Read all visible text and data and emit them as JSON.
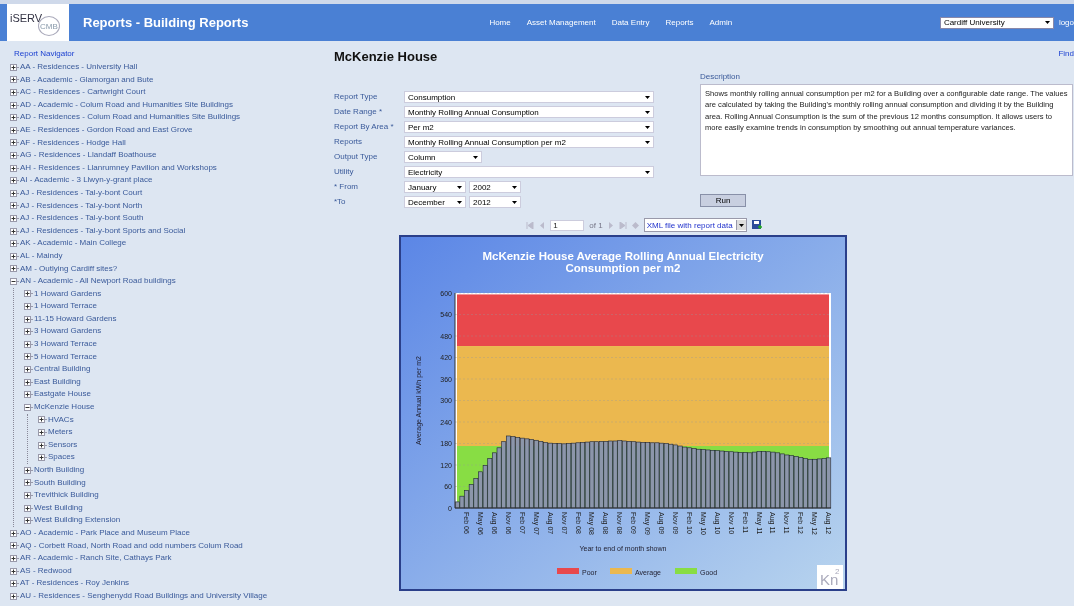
{
  "header": {
    "app_title": "Reports - Building Reports",
    "logo_text": "iSERV",
    "logo_sub": "CMB",
    "nav": [
      {
        "label": "Home"
      },
      {
        "label": "Asset Management"
      },
      {
        "label": "Data Entry"
      },
      {
        "label": "Reports"
      },
      {
        "label": "Admin"
      }
    ],
    "organisation": "Cardiff University",
    "logout": "logo"
  },
  "navigator": {
    "title": "Report Navigator",
    "tree": [
      {
        "label": "AA - Residences - University Hall",
        "expanded": false
      },
      {
        "label": "AB - Academic - Glamorgan and Bute",
        "expanded": false
      },
      {
        "label": "AC - Residences - Cartwright Court",
        "expanded": false
      },
      {
        "label": "AD - Academic - Colum Road and Humanities Site Buildings",
        "expanded": false
      },
      {
        "label": "AD - Residences - Colum Road and Humanities Site Buildings",
        "expanded": false
      },
      {
        "label": "AE - Residences - Gordon Road and East Grove",
        "expanded": false
      },
      {
        "label": "AF - Residences - Hodge Hall",
        "expanded": false
      },
      {
        "label": "AG - Residences - Llandaff Boathouse",
        "expanded": false
      },
      {
        "label": "AH - Residences - Llanrumney Pavilion and Workshops",
        "expanded": false
      },
      {
        "label": "AI - Academic - 3 Llwyn-y-grant place",
        "expanded": false
      },
      {
        "label": "AJ - Residences - Tal-y-bont Court",
        "expanded": false
      },
      {
        "label": "AJ - Residences - Tal-y-bont North",
        "expanded": false
      },
      {
        "label": "AJ - Residences - Tal-y-bont South",
        "expanded": false
      },
      {
        "label": "AJ - Residences - Tal-y-bont Sports and Social",
        "expanded": false
      },
      {
        "label": "AK - Academic - Main College",
        "expanded": false
      },
      {
        "label": "AL - Maindy",
        "expanded": false
      },
      {
        "label": "AM - Outlying Cardiff sites?",
        "expanded": false
      },
      {
        "label": "AN - Academic - All Newport Road buildings",
        "expanded": true,
        "children": [
          {
            "label": "1 Howard Gardens",
            "expanded": false
          },
          {
            "label": "1 Howard Terrace",
            "expanded": false
          },
          {
            "label": "11-15 Howard Gardens",
            "expanded": false
          },
          {
            "label": "3 Howard Gardens",
            "expanded": false
          },
          {
            "label": "3 Howard Terrace",
            "expanded": false
          },
          {
            "label": "5 Howard Terrace",
            "expanded": false
          },
          {
            "label": "Central Building",
            "expanded": false
          },
          {
            "label": "East Building",
            "expanded": false
          },
          {
            "label": "Eastgate House",
            "expanded": false
          },
          {
            "label": "McKenzie House",
            "expanded": true,
            "children": [
              {
                "label": "HVACs",
                "expanded": false
              },
              {
                "label": "Meters",
                "expanded": false
              },
              {
                "label": "Sensors",
                "expanded": false
              },
              {
                "label": "Spaces",
                "expanded": false
              }
            ]
          },
          {
            "label": "North Building",
            "expanded": false
          },
          {
            "label": "South Building",
            "expanded": false
          },
          {
            "label": "Trevithick Building",
            "expanded": false
          },
          {
            "label": "West Building",
            "expanded": false
          },
          {
            "label": "West Building Extension",
            "expanded": false
          }
        ]
      },
      {
        "label": "AO - Academic - Park Place and Museum Place",
        "expanded": false
      },
      {
        "label": "AQ - Corbett Road, North Road and odd numbers Colum Road",
        "expanded": false
      },
      {
        "label": "AR - Academic - Ranch Site, Cathays Park",
        "expanded": false
      },
      {
        "label": "AS - Redwood",
        "expanded": false
      },
      {
        "label": "AT - Residences - Roy Jenkins",
        "expanded": false
      },
      {
        "label": "AU - Residences - Senghenydd Road Buildings and University Village",
        "expanded": false
      }
    ]
  },
  "page_title": "McKenzie House",
  "find_link": "Find",
  "form": {
    "fields": [
      {
        "label": "Report Type",
        "values": [
          "Consumption"
        ],
        "kind": "wide"
      },
      {
        "label": "Date Range *",
        "values": [
          "Monthly Rolling Annual Consumption"
        ],
        "kind": "wide"
      },
      {
        "label": "Report By Area *",
        "values": [
          "Per m2"
        ],
        "kind": "wide"
      },
      {
        "label": "Reports",
        "values": [
          "Monthly Rolling Annual Consumption per m2"
        ],
        "kind": "wide"
      },
      {
        "label": "Output Type",
        "values": [
          "Column"
        ],
        "kind": "short"
      },
      {
        "label": "Utility",
        "values": [
          "Electricity"
        ],
        "kind": "wide"
      },
      {
        "label": "* From",
        "values": [
          "January",
          "2002"
        ],
        "kind": "date"
      },
      {
        "label": "*To",
        "values": [
          "December",
          "2012"
        ],
        "kind": "date"
      }
    ],
    "description_label": "Description",
    "description": "Shows monthly rolling annual consumption per m2 for a Building over a configurable date range. The values are calculated by taking the Building's monthly rolling annual consumption and dividing it by the Building area. Rolling Annual Consumption is the sum of the previous 12 months consumption. It allows users to more easily examine trends in consumption by smoothing out annual temperature variances.",
    "run_button": "Run"
  },
  "pager": {
    "page": "1",
    "of": "of 1",
    "export_format": "XML file with report data"
  },
  "chart": {
    "watermark": "Kn",
    "watermark_sup": "2",
    "chart_data": {
      "type": "bar",
      "title": "McKenzie House Average Rolling Annual Electricity Consumption per m2",
      "xlabel": "Year to end of month shown",
      "ylabel": "Average Annual kWh per m2",
      "categories": [
        null,
        null,
        "Feb 06",
        null,
        null,
        "May 06",
        null,
        null,
        "Aug 06",
        null,
        null,
        "Nov 06",
        null,
        null,
        "Feb 07",
        null,
        null,
        "May 07",
        null,
        null,
        "Aug 07",
        null,
        null,
        "Nov 07",
        null,
        null,
        "Feb 08",
        null,
        null,
        "May 08",
        null,
        null,
        "Aug 08",
        null,
        null,
        "Nov 08",
        null,
        null,
        "Feb 09",
        null,
        null,
        "May 09",
        null,
        null,
        "Aug 09",
        null,
        null,
        "Nov 09",
        null,
        null,
        "Feb 10",
        null,
        null,
        "May 10",
        null,
        null,
        "Aug 10",
        null,
        null,
        "Nov 10",
        null,
        null,
        "Feb 11",
        null,
        null,
        "May 11",
        null,
        null,
        "Aug 11",
        null,
        null,
        "Nov 11",
        null,
        null,
        "Feb 12",
        null,
        null,
        "May 12",
        null,
        null,
        "Aug 12"
      ],
      "series": [
        {
          "color": "#8c96aa",
          "values": [
            17,
            33,
            49,
            66,
            82,
            101,
            119,
            138,
            154,
            168,
            185,
            201,
            199,
            197,
            195,
            193,
            191,
            189,
            186,
            183,
            181,
            180,
            180,
            179,
            180,
            181,
            182,
            183,
            184,
            185,
            185,
            186,
            186,
            187,
            187,
            188,
            187,
            186,
            185,
            184,
            183,
            183,
            182,
            182,
            181,
            180,
            178,
            176,
            173,
            170,
            168,
            166,
            164,
            163,
            162,
            161,
            160,
            159,
            158,
            157,
            156,
            155,
            155,
            154,
            156,
            158,
            158,
            157,
            156,
            154,
            151,
            148,
            146,
            144,
            141,
            138,
            136,
            136,
            137,
            138,
            140
          ]
        }
      ],
      "ylim": [
        0,
        600
      ],
      "yticks": [
        0,
        60,
        120,
        180,
        240,
        300,
        360,
        420,
        480,
        540,
        600
      ],
      "grid": true,
      "legend": "bottom",
      "bands": [
        {
          "label": "Poor",
          "axis": "y",
          "from": 452,
          "to": 596,
          "color": "#e8484c"
        },
        {
          "label": "Average",
          "axis": "y",
          "from": 173,
          "to": 452,
          "color": "#ebb84f"
        },
        {
          "label": "Good",
          "axis": "y",
          "from": 0,
          "to": 173,
          "color": "#88dd44"
        }
      ]
    }
  }
}
